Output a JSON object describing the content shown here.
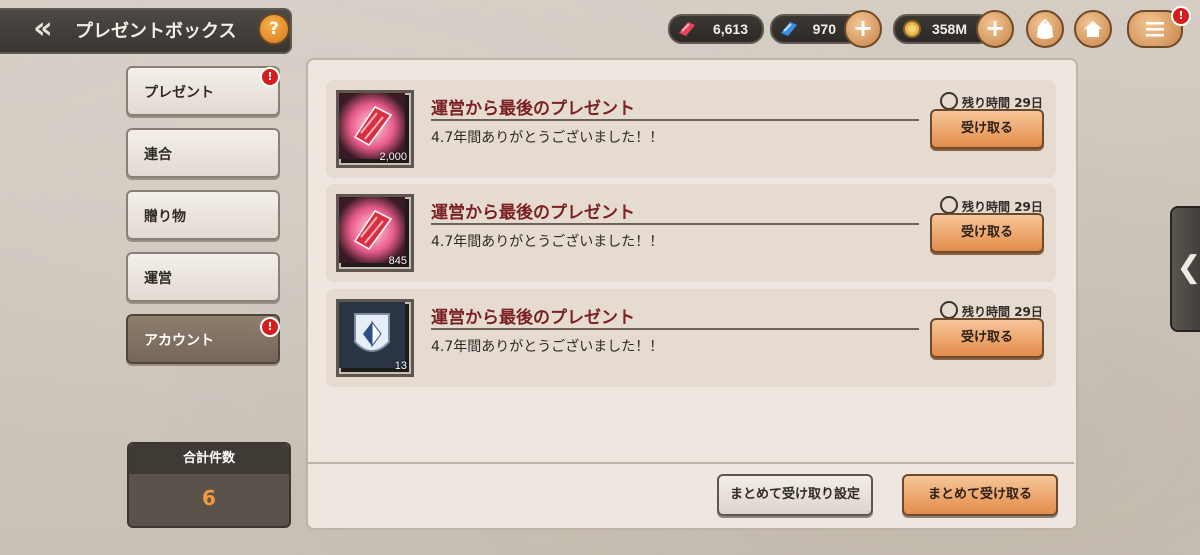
{
  "header": {
    "back_glyph": "«",
    "title": "プレゼントボックス",
    "help_glyph": "?"
  },
  "currencies": [
    {
      "icon": "red-crystal-icon",
      "value": "6,613"
    },
    {
      "icon": "blue-crystal-icon",
      "value": "970"
    },
    {
      "icon": "gold-coin-icon",
      "value": "358M"
    }
  ],
  "plus_glyph": "+",
  "badge_glyph": "!",
  "tabs": [
    {
      "label": "プレゼント",
      "badge": true
    },
    {
      "label": "連合",
      "badge": false
    },
    {
      "label": "贈り物",
      "badge": false
    },
    {
      "label": "運営",
      "badge": false
    },
    {
      "label": "アカウント",
      "badge": true
    }
  ],
  "total": {
    "label": "合計件数",
    "value": "6"
  },
  "items": [
    {
      "title": "運営から最後のプレゼント",
      "desc": "4.7年間ありがとうございました！！",
      "time_label": "残り時間",
      "time_value": "29日",
      "qty": "2,000",
      "icon": "red-crystal-icon",
      "button": "受け取る"
    },
    {
      "title": "運営から最後のプレゼント",
      "desc": "4.7年間ありがとうございました！！",
      "time_label": "残り時間",
      "time_value": "29日",
      "qty": "845",
      "icon": "red-crystal-icon",
      "button": "受け取る"
    },
    {
      "title": "運営から最後のプレゼント",
      "desc": "4.7年間ありがとうございました！！",
      "time_label": "残り時間",
      "time_value": "29日",
      "qty": "13",
      "icon": "wings-emblem-icon",
      "button": "受け取る"
    }
  ],
  "bottom": {
    "settings_label": "まとめて受け取り設定",
    "receive_all_label": "まとめて受け取る"
  },
  "side_tab_glyph": "❮",
  "colors": {
    "accent_orange": "#e38c4a",
    "title_red": "#7a1f22",
    "total_orange": "#f59a3b"
  }
}
